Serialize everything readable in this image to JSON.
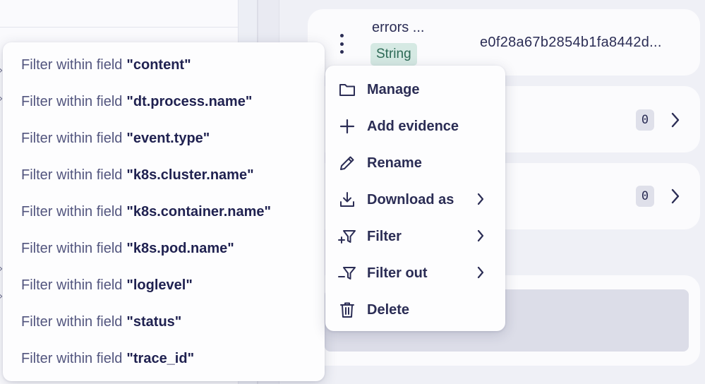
{
  "field_card": {
    "name": "errors ...",
    "type_badge": "String",
    "value": "e0f28a67b2854b1fa8442d..."
  },
  "count_cards": [
    {
      "count": "0"
    },
    {
      "count": "0"
    }
  ],
  "filter_submenu": {
    "prefix": "Filter within field",
    "items": [
      "\"content\"",
      "\"dt.process.name\"",
      "\"event.type\"",
      "\"k8s.cluster.name\"",
      "\"k8s.container.name\"",
      "\"k8s.pod.name\"",
      "\"loglevel\"",
      "\"status\"",
      "\"trace_id\""
    ]
  },
  "context_menu": {
    "items": [
      {
        "label": "Manage",
        "icon": "folder-icon",
        "has_submenu": false
      },
      {
        "label": "Add evidence",
        "icon": "plus-icon",
        "has_submenu": false
      },
      {
        "label": "Rename",
        "icon": "pencil-icon",
        "has_submenu": false
      },
      {
        "label": "Download as",
        "icon": "download-icon",
        "has_submenu": true
      },
      {
        "label": "Filter",
        "icon": "filter-add-icon",
        "has_submenu": true
      },
      {
        "label": "Filter out",
        "icon": "filter-remove-icon",
        "has_submenu": true
      },
      {
        "label": "Delete",
        "icon": "trash-icon",
        "has_submenu": false
      }
    ]
  },
  "colors": {
    "text": "#2b2d55",
    "badge_bg": "#d5e9e3",
    "badge_text": "#2d6a56",
    "menu_bg": "#fdfdfe",
    "page_bg": "#eff0f6"
  }
}
